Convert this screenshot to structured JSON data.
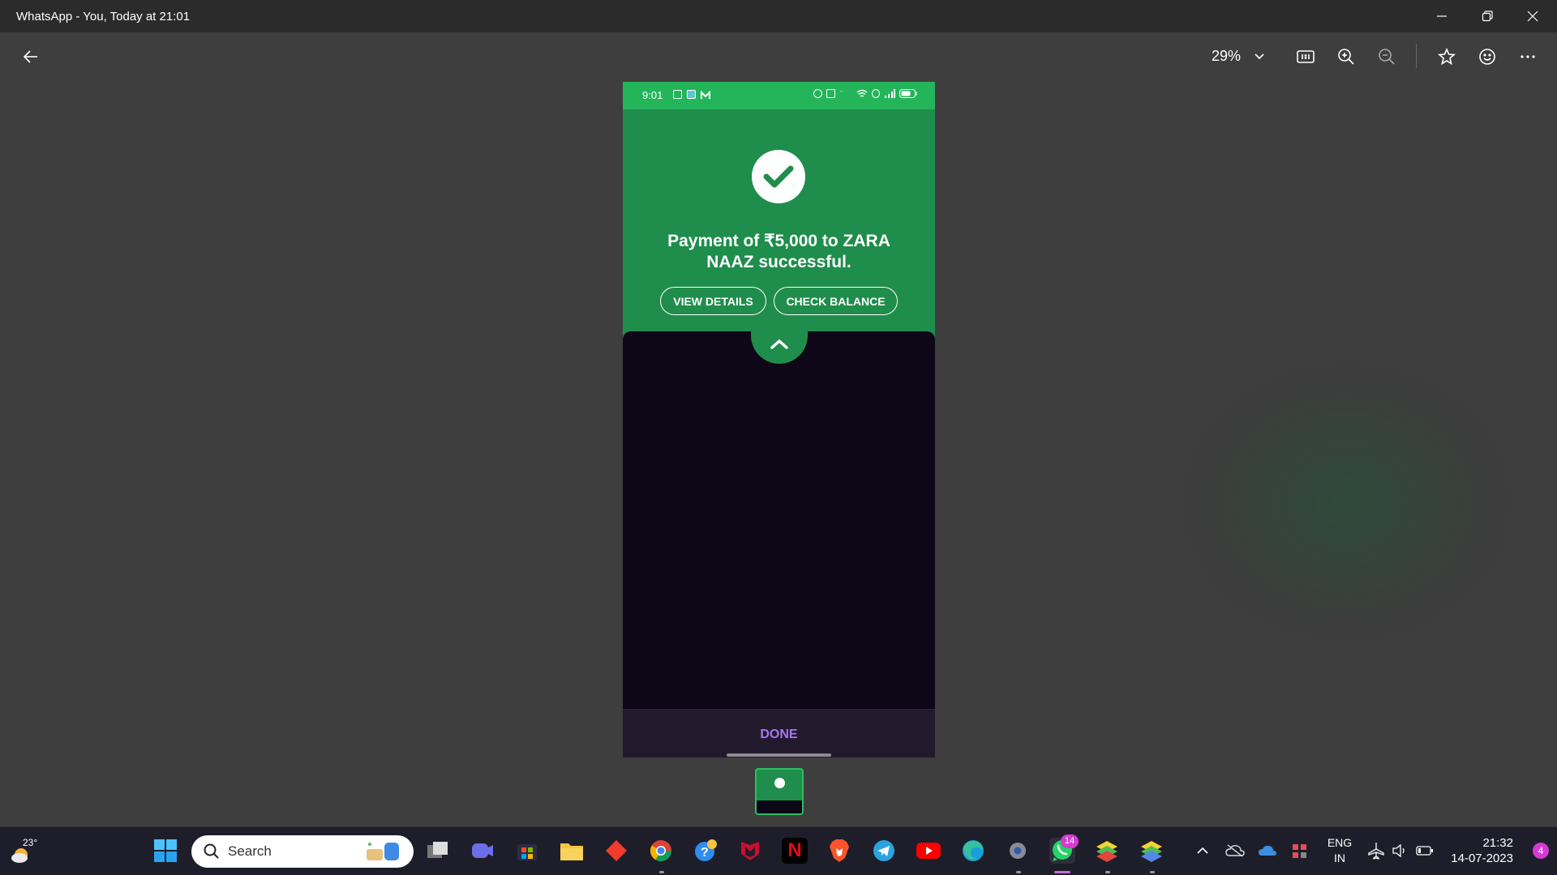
{
  "window": {
    "title": "WhatsApp - You, Today at 21:01"
  },
  "toolbar": {
    "zoom_level": "29%",
    "icons": [
      "back-arrow-icon",
      "chevron-down-icon",
      "actual-size-icon",
      "zoom-in-icon",
      "zoom-out-icon",
      "star-icon",
      "smiley-icon",
      "more-icon"
    ]
  },
  "phone": {
    "status_time": "9:01",
    "message_line1": "Payment of ₹5,000 to ZARA",
    "message_line2": "NAAZ successful.",
    "view_details": "VIEW DETAILS",
    "check_balance": "CHECK BALANCE",
    "done_label": "DONE"
  },
  "taskbar": {
    "temperature": "23°",
    "search_placeholder": "Search",
    "whatsapp_badge": "14",
    "lang_line1": "ENG",
    "lang_line2": "IN",
    "time": "21:32",
    "date": "14-07-2023",
    "notification_count": "4"
  },
  "colors": {
    "status_green": "#24b55a",
    "success_green": "#1f8d4b",
    "dark_sheet": "#0d0717",
    "done_purple": "#a777f0",
    "badge_pink": "#d63ad4"
  }
}
